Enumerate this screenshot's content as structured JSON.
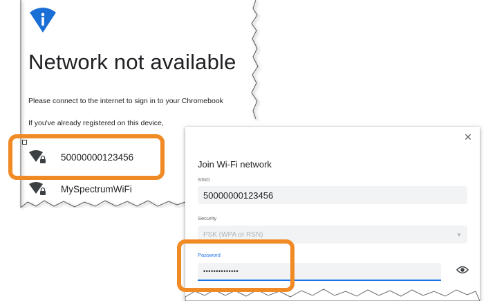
{
  "back_screen": {
    "title": "Network not available",
    "message": "Please connect to the internet to sign in to your Chromebook",
    "registered_message": "If you've already registered on this device,",
    "networks": [
      {
        "name": "50000000123456",
        "icon": "wifi-locked-icon"
      },
      {
        "name": "MySpectrumWiFi",
        "icon": "wifi-locked-icon"
      }
    ]
  },
  "dialog": {
    "title": "Join Wi-Fi network",
    "close_icon": "close-icon",
    "ssid_label": "SSID",
    "ssid_value": "50000000123456",
    "security_label": "Security",
    "security_value": "PSK (WPA or RSN)",
    "password_label": "Password",
    "password_value": "••••••••••••••",
    "eye_icon": "eye-icon"
  },
  "colors": {
    "highlight": "#f08a24",
    "info_blue": "#1a73e8",
    "field_bg": "#f1f3f4"
  }
}
